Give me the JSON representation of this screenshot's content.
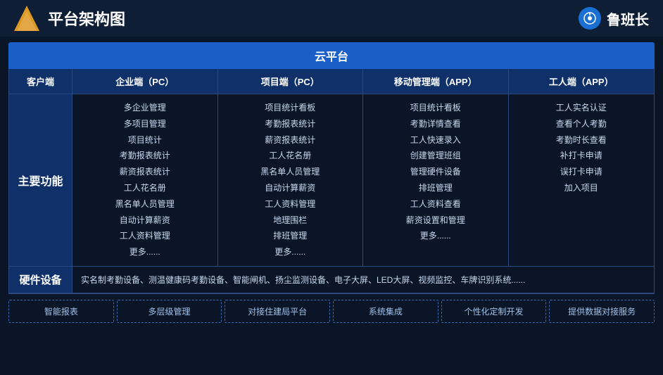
{
  "header": {
    "title": "平台架构图",
    "brand_name": "鲁班长"
  },
  "cloud_platform": {
    "label": "云平台"
  },
  "table": {
    "headers": [
      "客户端",
      "企业端（PC）",
      "项目端（PC）",
      "移动管理端（APP）",
      "工人端（APP）"
    ],
    "main_function_label": "主要功能",
    "columns": {
      "enterprise_pc": [
        "多企业管理",
        "多项目管理",
        "项目统计",
        "考勤报表统计",
        "薪资报表统计",
        "工人花名册",
        "黑名单人员管理",
        "自动计算薪资",
        "工人资料管理",
        "更多......"
      ],
      "project_pc": [
        "项目统计看板",
        "考勤报表统计",
        "薪资报表统计",
        "工人花名册",
        "黑名单人员管理",
        "自动计算薪资",
        "工人资料管理",
        "地理围栏",
        "排班管理",
        "更多......"
      ],
      "mobile_app": [
        "项目统计看板",
        "考勤详情查看",
        "工人快速录入",
        "创建管理班组",
        "管理硬件设备",
        "排班管理",
        "工人资料查看",
        "薪资设置和管理",
        "更多......"
      ],
      "worker_app": [
        "工人实名认证",
        "查看个人考勤",
        "考勤时长查看",
        "补打卡申请",
        "误打卡申请",
        "加入项目"
      ]
    },
    "hardware_label": "硬件设备",
    "hardware_content": "实名制考勤设备、测温健康码考勤设备、智能闸机、扬尘监测设备、电子大屏、LED大屏、视频监控、车牌识别系统......"
  },
  "bottom_items": [
    "智能报表",
    "多层级管理",
    "对接住建局平台",
    "系统集成",
    "个性化定制开发",
    "提供数据对接服务"
  ]
}
